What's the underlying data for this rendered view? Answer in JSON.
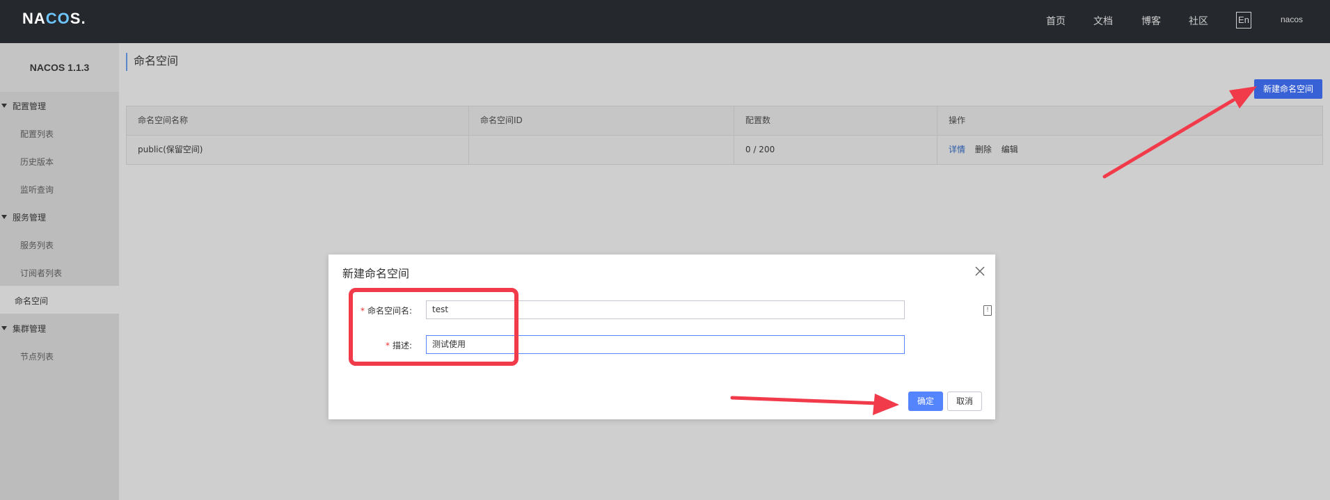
{
  "header": {
    "logo_prefix": "NA",
    "logo_accent": "CO",
    "logo_suffix": "S.",
    "nav": [
      "首页",
      "文档",
      "博客",
      "社区"
    ],
    "lang": "En",
    "user": "nacos"
  },
  "sidebar": {
    "version": "NACOS 1.1.3",
    "groups": [
      {
        "label": "配置管理",
        "items": [
          "配置列表",
          "历史版本",
          "监听查询"
        ]
      },
      {
        "label": "服务管理",
        "items": [
          "服务列表",
          "订阅者列表"
        ]
      },
      {
        "label": "命名空间",
        "items": []
      },
      {
        "label": "集群管理",
        "items": [
          "节点列表"
        ]
      }
    ]
  },
  "main": {
    "title": "命名空间",
    "new_button": "新建命名空间",
    "table": {
      "headers": [
        "命名空间名称",
        "命名空间ID",
        "配置数",
        "操作"
      ],
      "rows": [
        {
          "name": "public(保留空间)",
          "id": "",
          "count": "0 / 200",
          "ops": [
            "详情",
            "删除",
            "编辑"
          ]
        }
      ]
    }
  },
  "dialog": {
    "title": "新建命名空间",
    "name_label": "命名空间名:",
    "name_value": "test",
    "desc_label": "描述:",
    "desc_value": "测试使用",
    "required_mark": "*",
    "ok": "确定",
    "cancel": "取消"
  },
  "colors": {
    "primary": "#5584ff",
    "annotation": "#f23b4a",
    "header_bg": "#25282c"
  }
}
